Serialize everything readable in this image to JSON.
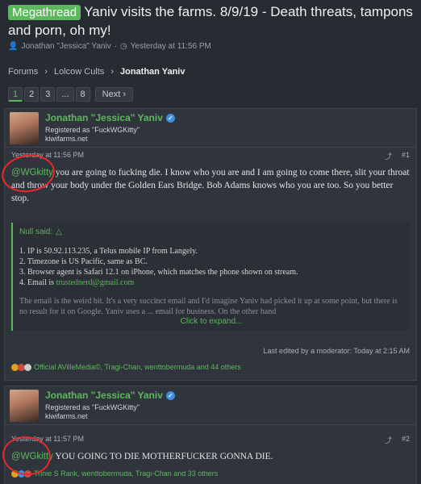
{
  "thread": {
    "prefix": "Megathread",
    "title": "Yaniv visits the farms. 8/9/19 - Death threats, tampons and porn, oh my!",
    "author": "Jonathan \"Jessica\" Yaniv",
    "date": "Yesterday at 11:56 PM"
  },
  "breadcrumb": [
    "Forums",
    "Lolcow Cults",
    "Jonathan Yaniv"
  ],
  "pager": {
    "pages": [
      "1",
      "2",
      "3",
      "...",
      "8"
    ],
    "next": "Next"
  },
  "posts": [
    {
      "username": "Jonathan \"Jessica\" Yaniv",
      "registered": "Registered as \"FuckWGKitty\"",
      "site": "kiwifarms.net",
      "time": "Yesterday at 11:56 PM",
      "number": "#1",
      "mention": "@WGkitty",
      "body": " you are going to fucking die. I know who you are and I am going to come there, slit your throat and throw your body under the Golden Ears Bridge. Bob Adams knows who you are too. So you better stop.",
      "quote": {
        "author": "Null said:",
        "lines": [
          "1. IP is 50.92.113.235, a Telus mobile IP from Langely.",
          "2. Timezone is US Pacific, same as BC.",
          "3. Browser agent is Safari 12.1 on iPhone, which matches the phone shown on stream."
        ],
        "email_prefix": "4. Email is ",
        "email": "trustednerd@gmail.com",
        "fade": "The email is the weird bit. It's a very succinct email and I'd imagine Yaniv had picked it up at some point, but there is no result for it on Google. Yaniv uses a ... email for business. On the other hand",
        "expand": "Click to expand..."
      },
      "edited": "Last edited by a moderator: Today at 2:15 AM",
      "reactions": "Official AVilleMedia©, Tragi-Chan, wenttobermuda and 44 others"
    },
    {
      "username": "Jonathan \"Jessica\" Yaniv",
      "registered": "Registered as \"FuckWGKitty\"",
      "site": "kiwifarms.net",
      "time": "Yesterday at 11:57 PM",
      "number": "#2",
      "mention": "@WGkitty",
      "body": " YOU GOING TO DIE MOTHERFUCKER GONNA DIE.",
      "reactions": "Trinie S Rank, wenttobermuda, Tragi-Chan and 33 others"
    }
  ],
  "colors": {
    "accent": "#5cb85c",
    "annotation": "#e8282e",
    "background": "#272b32"
  }
}
